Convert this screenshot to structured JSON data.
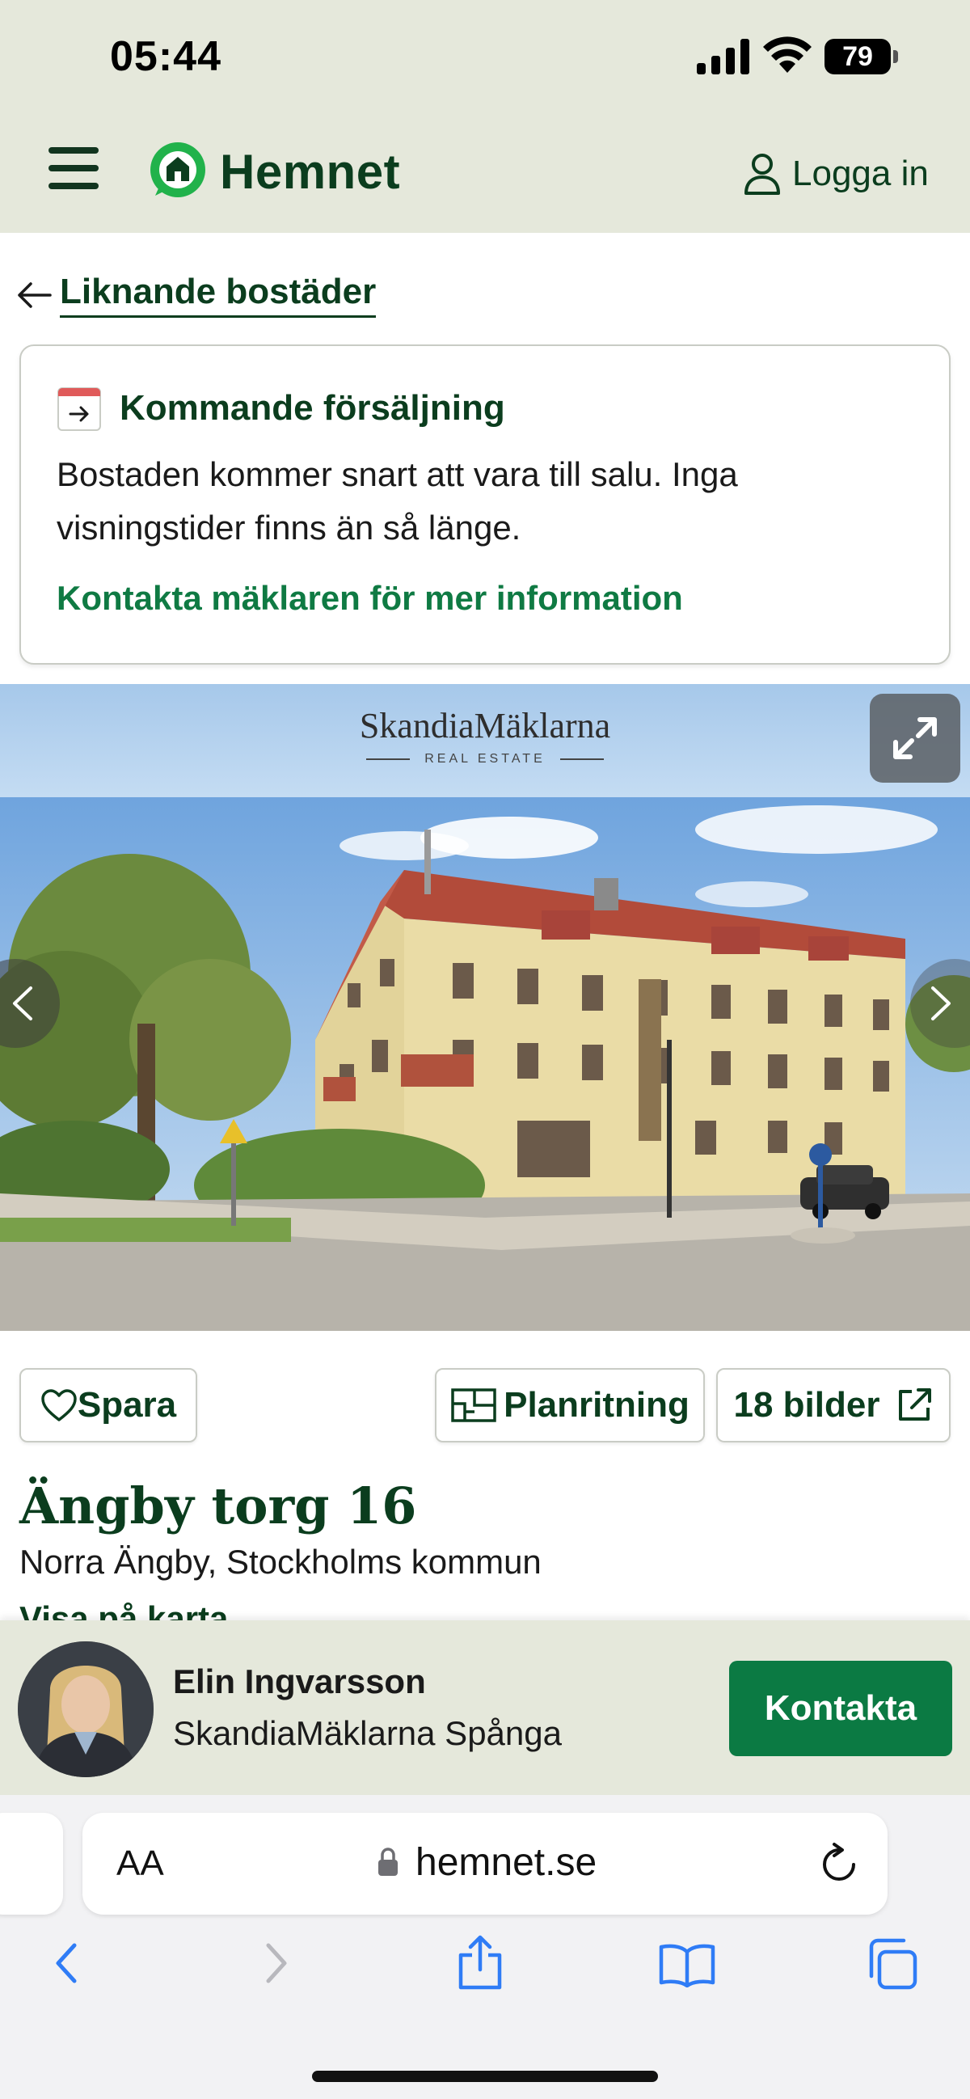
{
  "status_bar": {
    "time": "05:44",
    "battery": "79",
    "icons": [
      "cellular-signal-icon",
      "wifi-icon",
      "battery-icon"
    ]
  },
  "header": {
    "menu_icon": "hamburger-menu-icon",
    "brand": "Hemnet",
    "login_label": "Logga in",
    "login_icon": "person-icon"
  },
  "back_link": {
    "label": "Liknande bostäder",
    "icon": "arrow-left-icon"
  },
  "notice": {
    "icon": "calendar-arrow-icon",
    "title": "Kommande försäljning",
    "text": "Bostaden kommer snart att vara till salu. Inga visningstider finns än så länge.",
    "link": "Kontakta mäklaren för mer information"
  },
  "gallery": {
    "banner_brand": "SkandiaMäklarna",
    "banner_sub": "REAL ESTATE",
    "photo_subject": "yellow three-storey apartment building with red roof at a street corner",
    "icons": [
      "expand-icon",
      "chevron-left-icon",
      "chevron-right-icon"
    ]
  },
  "actions": {
    "save_label": "Spara",
    "floorplan_label": "Planritning",
    "photos_label": "18 bilder",
    "icons": [
      "heart-icon",
      "floorplan-icon",
      "external-link-icon"
    ]
  },
  "listing": {
    "address": "Ängby torg 16",
    "area": "Norra Ängby, Stockholms kommun",
    "map_link": "Visa på karta"
  },
  "agent": {
    "name": "Elin Ingvarsson",
    "office": "SkandiaMäklarna Spånga",
    "contact_label": "Kontakta"
  },
  "browser": {
    "text_size_label": "AA",
    "url": "hemnet.se",
    "toolbar_icons": [
      "back-icon",
      "forward-icon",
      "share-icon",
      "bookmarks-icon",
      "tabs-icon"
    ]
  },
  "colors": {
    "brand_green": "#0b3d1e",
    "accent_green": "#0f7a43",
    "header_bg": "#e5e8db",
    "logo_green": "#21b24b"
  }
}
